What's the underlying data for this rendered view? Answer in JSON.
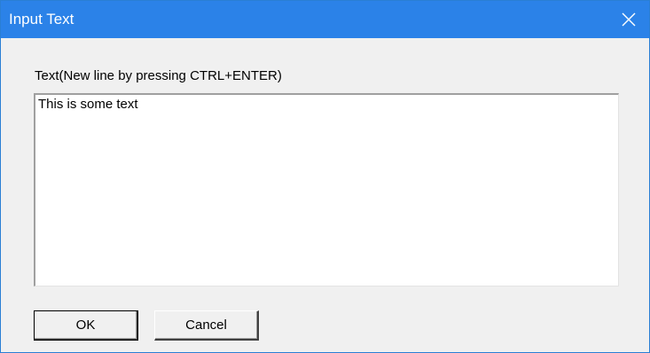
{
  "window": {
    "title": "Input Text"
  },
  "dialog": {
    "prompt_label": "Text(New line by pressing CTRL+ENTER)",
    "text_value": "This is some text",
    "ok_label": "OK",
    "cancel_label": "Cancel"
  },
  "icons": {
    "close": "close-icon"
  },
  "colors": {
    "titlebar": "#2b82e8",
    "dialog_background": "#f0f0f0"
  }
}
